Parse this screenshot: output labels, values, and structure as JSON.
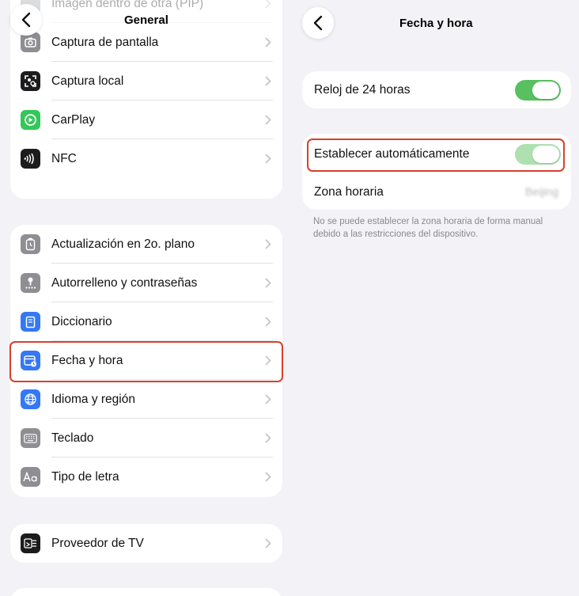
{
  "left": {
    "title": "General",
    "faded_top_item": "Imagen dentro de otra (PIP)",
    "group1": [
      {
        "label": "Captura de pantalla",
        "icon": "screenshot-icon"
      },
      {
        "label": "Captura local",
        "icon": "local-capture-icon"
      },
      {
        "label": "CarPlay",
        "icon": "carplay-icon"
      },
      {
        "label": "NFC",
        "icon": "nfc-icon"
      }
    ],
    "group2": [
      {
        "label": "Actualización en 2o. plano",
        "icon": "background-refresh-icon"
      },
      {
        "label": "Autorrelleno y contraseñas",
        "icon": "autofill-key-icon"
      },
      {
        "label": "Diccionario",
        "icon": "dictionary-icon"
      },
      {
        "label": "Fecha y hora",
        "icon": "calendar-clock-icon"
      },
      {
        "label": "Idioma y región",
        "icon": "globe-icon"
      },
      {
        "label": "Teclado",
        "icon": "keyboard-icon"
      },
      {
        "label": "Tipo de letra",
        "icon": "font-icon"
      }
    ],
    "group3": [
      {
        "label": "Proveedor de TV",
        "icon": "tv-provider-icon"
      }
    ]
  },
  "right": {
    "title": "Fecha y hora",
    "clock24": {
      "label": "Reloj de 24 horas",
      "on": true
    },
    "auto_set": {
      "label": "Establecer automáticamente",
      "on": true,
      "disabled": true
    },
    "timezone": {
      "label": "Zona horaria",
      "value": "Beijing"
    },
    "note": "No se puede establecer la zona horaria de forma manual debido a las restricciones del dispositivo."
  },
  "colors": {
    "background": "#f2f2f7",
    "highlight": "#d9402c",
    "toggle_on": "#59c05f",
    "toggle_disabled": "#aee0b0"
  }
}
